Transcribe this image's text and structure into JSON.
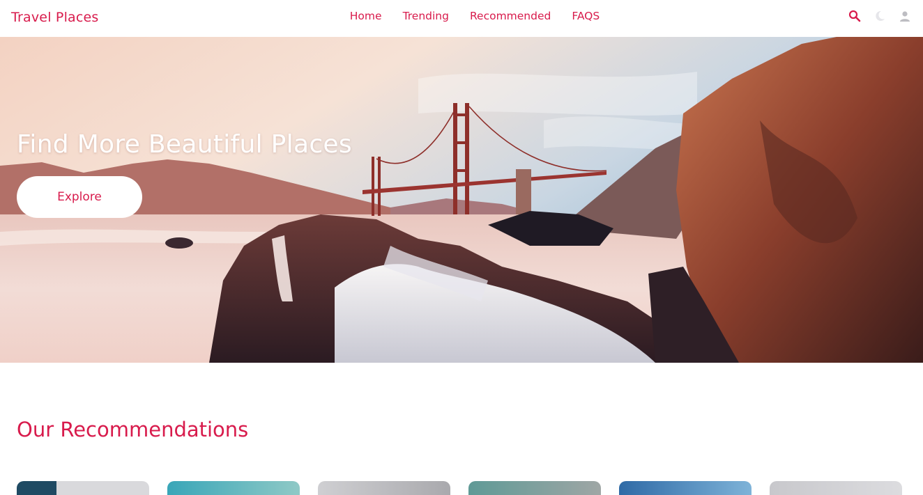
{
  "brand": "Travel Places",
  "nav": {
    "links": [
      "Home",
      "Trending",
      "Recommended",
      "FAQS"
    ]
  },
  "icons": {
    "search": "search-icon",
    "theme": "moon-icon",
    "user": "user-icon"
  },
  "hero": {
    "title": "Find More Beautiful Places",
    "button_label": "Explore"
  },
  "recommendations": {
    "title": "Our Recommendations"
  },
  "colors": {
    "accent": "#d81b4c",
    "background": "#ffffff"
  }
}
